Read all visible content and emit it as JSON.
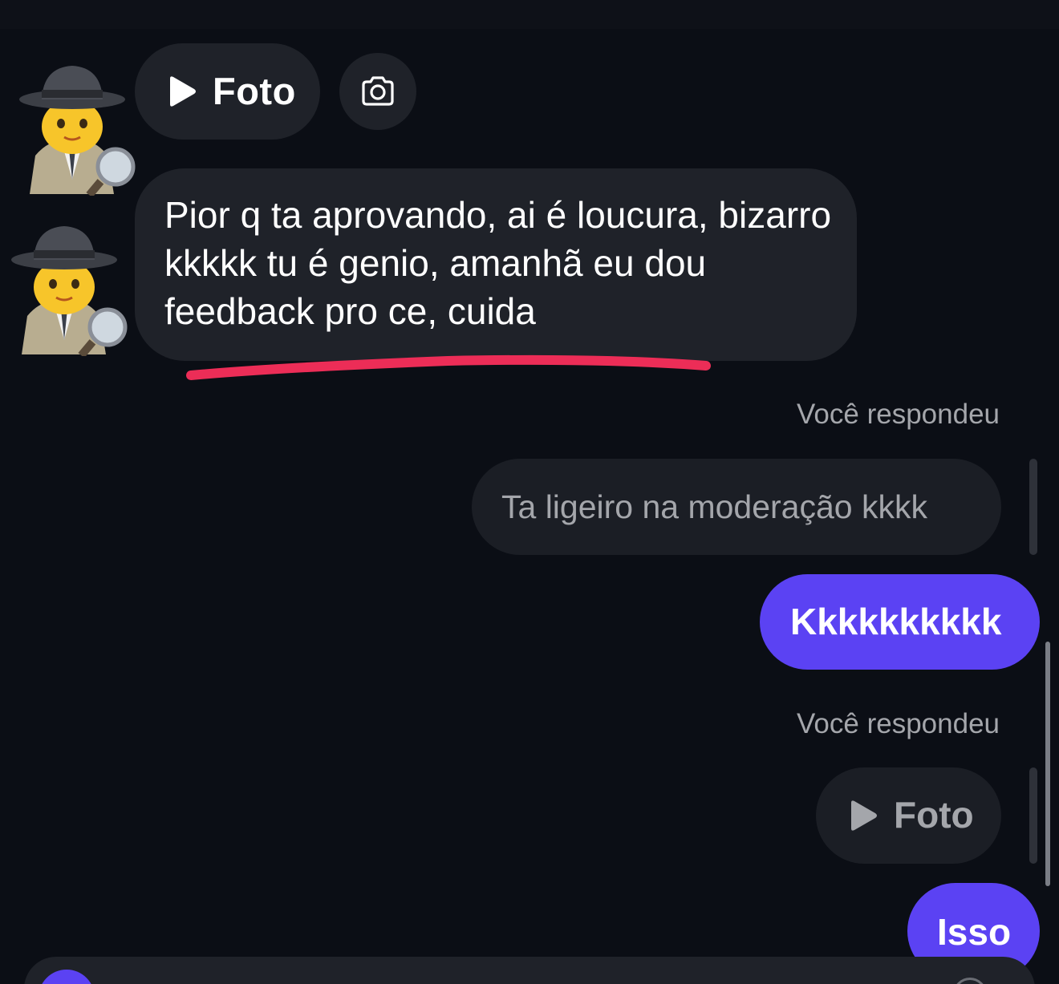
{
  "conversation": {
    "incoming_voice": {
      "label": "Foto",
      "icon": "play-icon"
    },
    "camera_button": {
      "icon": "camera-icon"
    },
    "incoming_message": "Pior q ta aprovando, ai é loucura, bizarro kkkkk tu é genio, amanhã eu dou feedback pro ce, cuida",
    "reply_1": {
      "label": "Você respondeu",
      "quoted": "Ta ligeiro na moderação kkkk",
      "message": "Kkkkkkkkkk"
    },
    "reply_2": {
      "label": "Você respondeu",
      "quoted_label": "Foto",
      "quoted_icon": "play-icon",
      "message": "Isso"
    }
  },
  "colors": {
    "background": "#0b0e15",
    "incoming_bubble": "#1f2229",
    "outgoing_bubble": "#5b42f3",
    "secondary_text": "#a4a6ab",
    "annotation": "#ec2d57"
  },
  "avatar_icons": [
    "detective-avatar-icon",
    "detective-avatar-icon"
  ]
}
